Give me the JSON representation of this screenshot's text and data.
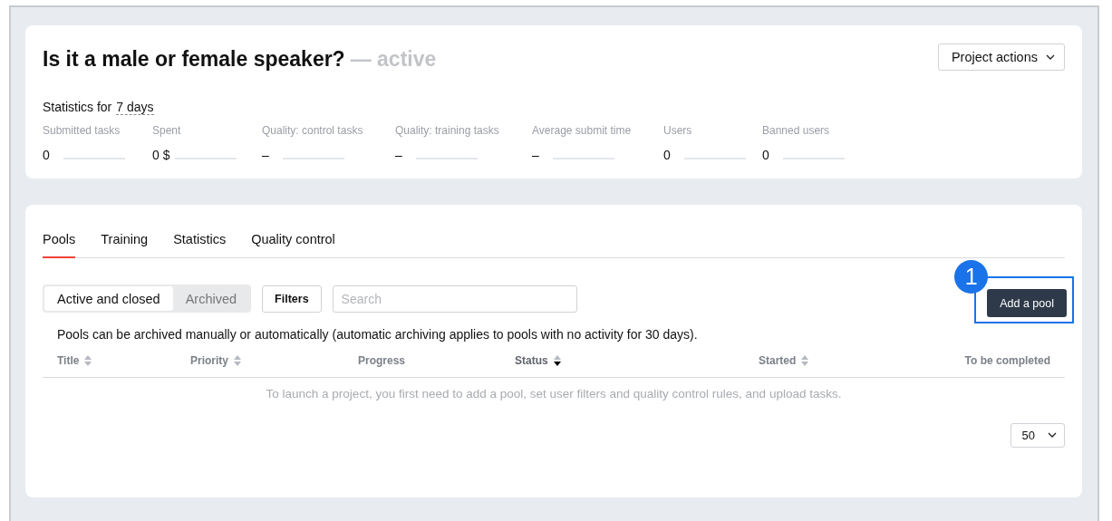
{
  "project": {
    "title": "Is it a male or female speaker?",
    "status": "— active",
    "actions_button": "Project actions"
  },
  "statistics": {
    "label": "Statistics for",
    "period": "7 days",
    "metrics": [
      {
        "name": "Submitted tasks",
        "value": "0"
      },
      {
        "name": "Spent",
        "value": "0 $"
      },
      {
        "name": "Quality: control tasks",
        "value": "–"
      },
      {
        "name": "Quality: training tasks",
        "value": "–"
      },
      {
        "name": "Average submit time",
        "value": "–"
      },
      {
        "name": "Users",
        "value": "0"
      },
      {
        "name": "Banned users",
        "value": "0"
      }
    ]
  },
  "tabs": [
    {
      "label": "Pools",
      "selected": true
    },
    {
      "label": "Training",
      "selected": false
    },
    {
      "label": "Statistics",
      "selected": false
    },
    {
      "label": "Quality control",
      "selected": false
    }
  ],
  "pool_filter": [
    {
      "label": "Active and closed",
      "selected": true
    },
    {
      "label": "Archived",
      "selected": false
    }
  ],
  "filters_button": "Filters",
  "search": {
    "placeholder": "Search"
  },
  "add_button": "Add a pool",
  "callout": {
    "number": "1"
  },
  "info": "Pools can be archived manually or automatically (automatic archiving applies to pools with no activity for 30 days).",
  "table": {
    "columns": [
      {
        "label": "Title",
        "sortable": true,
        "sorted": false
      },
      {
        "label": "Priority",
        "sortable": true,
        "sorted": false
      },
      {
        "label": "Progress",
        "sortable": false,
        "sorted": false
      },
      {
        "label": "Status",
        "sortable": true,
        "sorted": true
      },
      {
        "label": "Started",
        "sortable": true,
        "sorted": false
      },
      {
        "label": "To be completed",
        "sortable": false,
        "sorted": false
      }
    ],
    "empty_message": "To launch a project, you first need to add a pool, set user filters and quality control rules, and upload tasks."
  },
  "page_size": "50"
}
